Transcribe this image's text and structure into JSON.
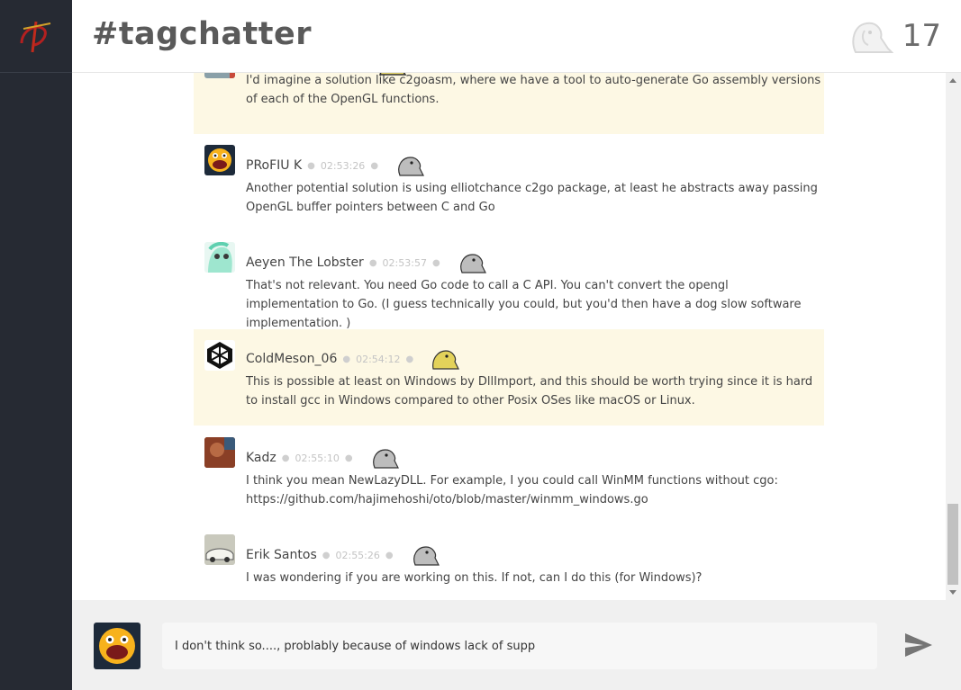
{
  "header": {
    "title": "#tagchatter",
    "online_count": "17",
    "online_icon": "parrot-icon"
  },
  "messages": [
    {
      "author": "",
      "time": "",
      "body": "I'd imagine a solution like c2goasm, where we have a tool to auto-generate Go assembly versions of each of the OpenGL functions.",
      "highlighted": true,
      "avatar": "avatar-partial",
      "mood_icon": "parrot-icon"
    },
    {
      "author": "PRoFIU K",
      "time": "02:53:26",
      "body": "Another potential solution is using elliotchance c2go package, at least he abstracts away passing OpenGL buffer pointers between C and Go",
      "highlighted": false,
      "avatar": "laughing-face-avatar",
      "mood_icon": "parrot-icon"
    },
    {
      "author": "Aeyen The Lobster",
      "time": "02:53:57",
      "body": "That's not relevant. You need Go code to call a C API. You can't convert the opengl implementation to Go. (I guess technically you could, but you'd then have a dog slow software implementation. )",
      "highlighted": false,
      "avatar": "pony-avatar",
      "mood_icon": "parrot-icon"
    },
    {
      "author": "ColdMeson_06",
      "time": "02:54:12",
      "body": "This is possible at least on Windows by DllImport, and this should be worth trying since it is hard to install gcc in Windows compared to other Posix OSes like macOS or Linux.",
      "highlighted": true,
      "avatar": "cube-logo-avatar",
      "mood_icon": "parrot-icon"
    },
    {
      "author": "Kadz",
      "time": "02:55:10",
      "body": "I think you mean NewLazyDLL. For example, I you could call WinMM functions without cgo: https://github.com/hajimehoshi/oto/blob/master/winmm_windows.go",
      "highlighted": false,
      "avatar": "photo-avatar",
      "mood_icon": "parrot-icon"
    },
    {
      "author": "Erik Santos",
      "time": "02:55:26",
      "body": "I was wondering if you are working on this. If not, can I do this (for Windows)?",
      "highlighted": false,
      "avatar": "car-avatar",
      "mood_icon": "parrot-icon"
    }
  ],
  "composer": {
    "value": "I don't think so...., problably because of windows lack of supp",
    "send_icon": "send-icon"
  },
  "colors": {
    "sidebar": "#262a33",
    "highlight": "#fdf8e4",
    "composer_bg": "#f0f0f0"
  }
}
